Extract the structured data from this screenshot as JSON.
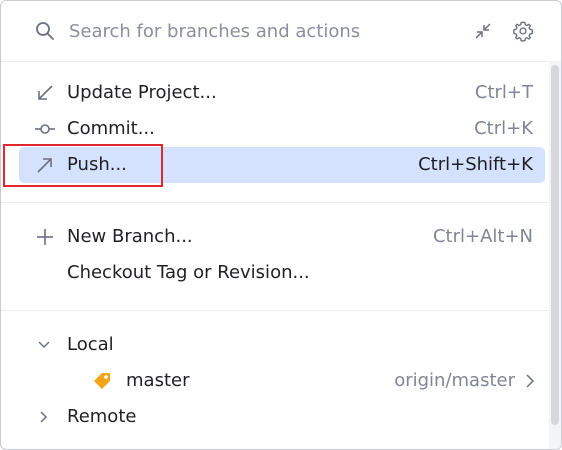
{
  "search": {
    "placeholder": "Search for branches and actions",
    "value": ""
  },
  "header_icons": [
    "collapse-arrows-icon",
    "gear-icon"
  ],
  "actions": [
    {
      "label": "Update Project...",
      "shortcut": "Ctrl+T",
      "icon": "arrow-down-left-icon",
      "selected": false
    },
    {
      "label": "Commit...",
      "shortcut": "Ctrl+K",
      "icon": "commit-icon",
      "selected": false
    },
    {
      "label": "Push...",
      "shortcut": "Ctrl+Shift+K",
      "icon": "arrow-up-right-icon",
      "selected": true
    }
  ],
  "branch_actions": [
    {
      "label": "New Branch...",
      "shortcut": "Ctrl+Alt+N",
      "icon": "plus-icon"
    },
    {
      "label": "Checkout Tag or Revision...",
      "shortcut": "",
      "icon": ""
    }
  ],
  "tree": {
    "local": {
      "label": "Local",
      "expanded": true
    },
    "master": {
      "label": "master",
      "tracking": "origin/master",
      "icon": "tag-icon"
    },
    "remote": {
      "label": "Remote",
      "expanded": false
    }
  },
  "colors": {
    "selection": "#d4e2ff",
    "highlight_box": "#e0282e",
    "tag_icon": "#f2a516",
    "shortcut_text": "#818594"
  }
}
